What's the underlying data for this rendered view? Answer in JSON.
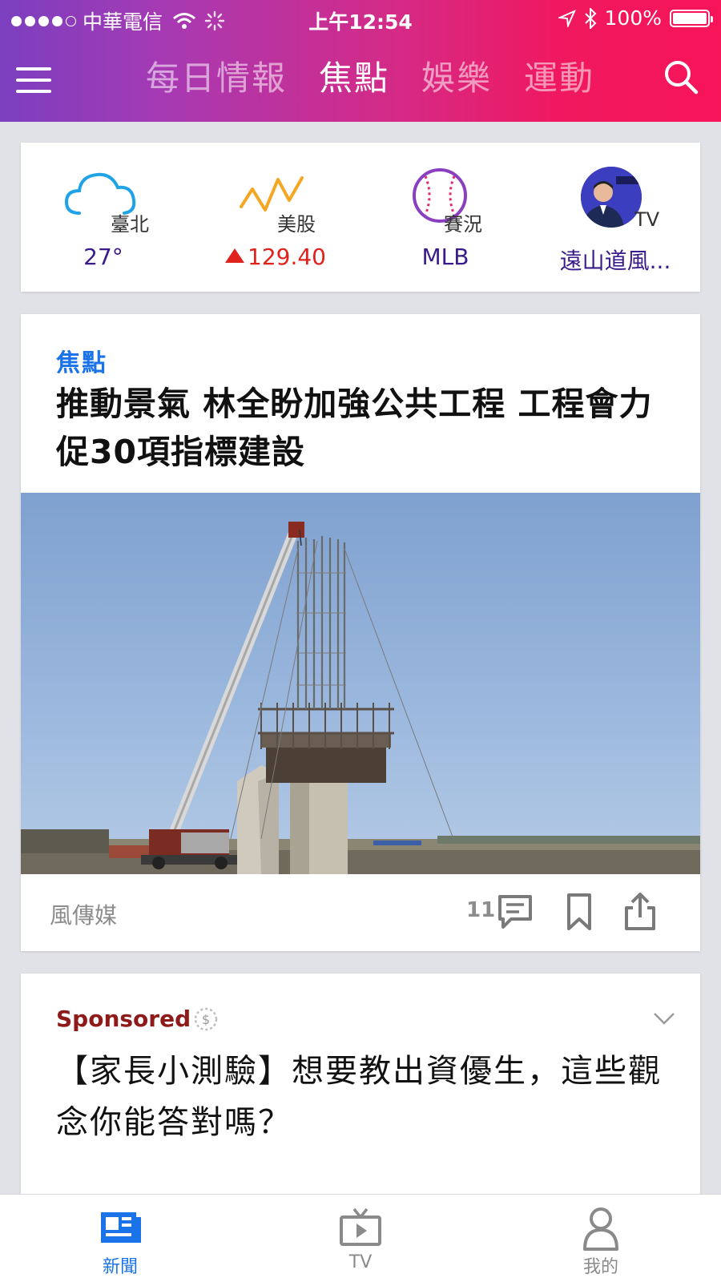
{
  "status_bar": {
    "carrier": "中華電信",
    "time": "上午12:54",
    "battery": "100%"
  },
  "nav": {
    "tabs": [
      {
        "label": "每日情報",
        "active": false
      },
      {
        "label": "焦點",
        "active": true
      },
      {
        "label": "娛樂",
        "active": false
      },
      {
        "label": "運動",
        "active": false
      }
    ],
    "icons": {
      "menu": "hamburger-icon",
      "search": "search-icon"
    }
  },
  "quick_links": [
    {
      "icon": "cloud-icon",
      "label": "臺北",
      "value": "27°"
    },
    {
      "icon": "stock-line-icon",
      "label": "美股",
      "value": "129.40",
      "trend": "up"
    },
    {
      "icon": "baseball-icon",
      "label": "賽況",
      "value": "MLB"
    },
    {
      "icon": "tv-host-avatar",
      "label": "TV",
      "value": "遠山道風..."
    }
  ],
  "article": {
    "category": "焦點",
    "headline": "推動景氣 林全盼加強公共工程 工程會力促30項指標建設",
    "source": "風傳媒",
    "comment_count": "11",
    "icons": {
      "comment": "comment-icon",
      "bookmark": "bookmark-icon",
      "share": "share-icon"
    }
  },
  "sponsored": {
    "label": "Sponsored",
    "title": "【家長小測驗】想要教出資優生，這些觀念你能答對嗎？"
  },
  "bottom_tabs": [
    {
      "label": "新聞",
      "icon": "news-icon",
      "active": true
    },
    {
      "label": "TV",
      "icon": "tv-icon",
      "active": false
    },
    {
      "label": "我的",
      "icon": "profile-icon",
      "active": false
    }
  ],
  "colors": {
    "header_gradient_start": "#7b3fbf",
    "header_gradient_end": "#f71459",
    "accent_blue": "#1a73e8",
    "value_purple": "#3a1b8c",
    "stock_up_red": "#e0221c",
    "sponsored_red": "#8e1a1a"
  }
}
